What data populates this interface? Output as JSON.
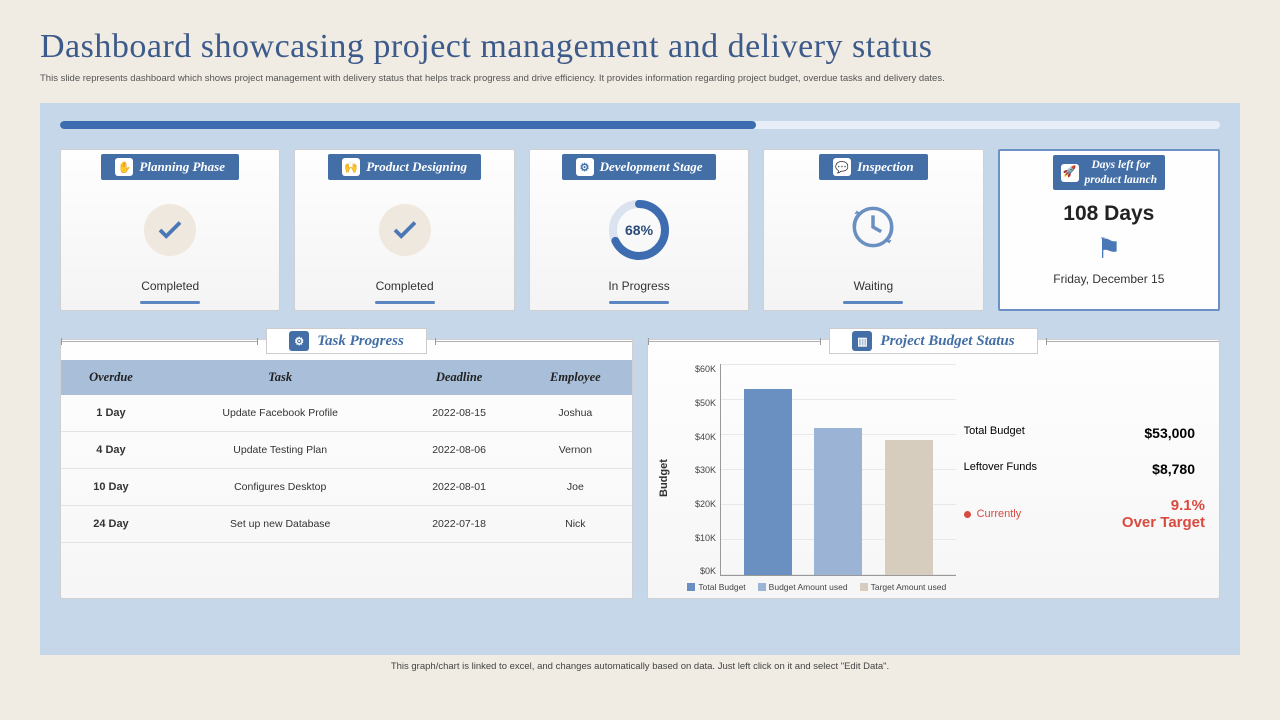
{
  "title": "Dashboard showcasing project management and delivery status",
  "subtitle": "This slide represents dashboard which shows project management with delivery status that helps track progress and drive efficiency. It provides information regarding project budget, overdue tasks and delivery dates.",
  "top_progress_pct": 60,
  "phases": [
    {
      "name": "Planning Phase",
      "status": "Completed",
      "kind": "check"
    },
    {
      "name": "Product Designing",
      "status": "Completed",
      "kind": "check"
    },
    {
      "name": "Development Stage",
      "status": "In Progress",
      "kind": "gauge",
      "pct": 68
    },
    {
      "name": "Inspection",
      "status": "Waiting",
      "kind": "wait"
    }
  ],
  "launch": {
    "header": "Days left for product launch",
    "days_text": "108 Days",
    "date_text": "Friday, December 15"
  },
  "task_panel": {
    "title": "Task Progress",
    "headers": [
      "Overdue",
      "Task",
      "Deadline",
      "Employee"
    ],
    "rows": [
      [
        "1 Day",
        "Update Facebook Profile",
        "2022-08-15",
        "Joshua"
      ],
      [
        "4 Day",
        "Update Testing Plan",
        "2022-08-06",
        "Vernon"
      ],
      [
        "10 Day",
        "Configures Desktop",
        "2022-08-01",
        "Joe"
      ],
      [
        "24 Day",
        "Set up new Database",
        "2022-07-18",
        "Nick"
      ]
    ]
  },
  "budget_panel": {
    "title": "Project Budget Status",
    "total_label": "Total Budget",
    "total_value": "$53,000",
    "left_label": "Leftover Funds",
    "left_value": "$8,780",
    "currently_label": "Currently",
    "over_pct": "9.1%",
    "over_text": "Over Target"
  },
  "chart_data": {
    "type": "bar",
    "ylabel": "Budget",
    "ylim": [
      0,
      60000
    ],
    "ticks": [
      "$60K",
      "$50K",
      "$40K",
      "$30K",
      "$20K",
      "$10K",
      "$0K"
    ],
    "series": [
      {
        "name": "Total Budget",
        "value": 53000,
        "color": "#6a8fc1"
      },
      {
        "name": "Budget Amount used",
        "value": 42000,
        "color": "#9bb4d5"
      },
      {
        "name": "Target Amount used",
        "value": 38500,
        "color": "#d7cdbf"
      }
    ]
  },
  "footer": "This graph/chart is linked to excel, and changes automatically based on data. Just left click on it and select \"Edit Data\"."
}
